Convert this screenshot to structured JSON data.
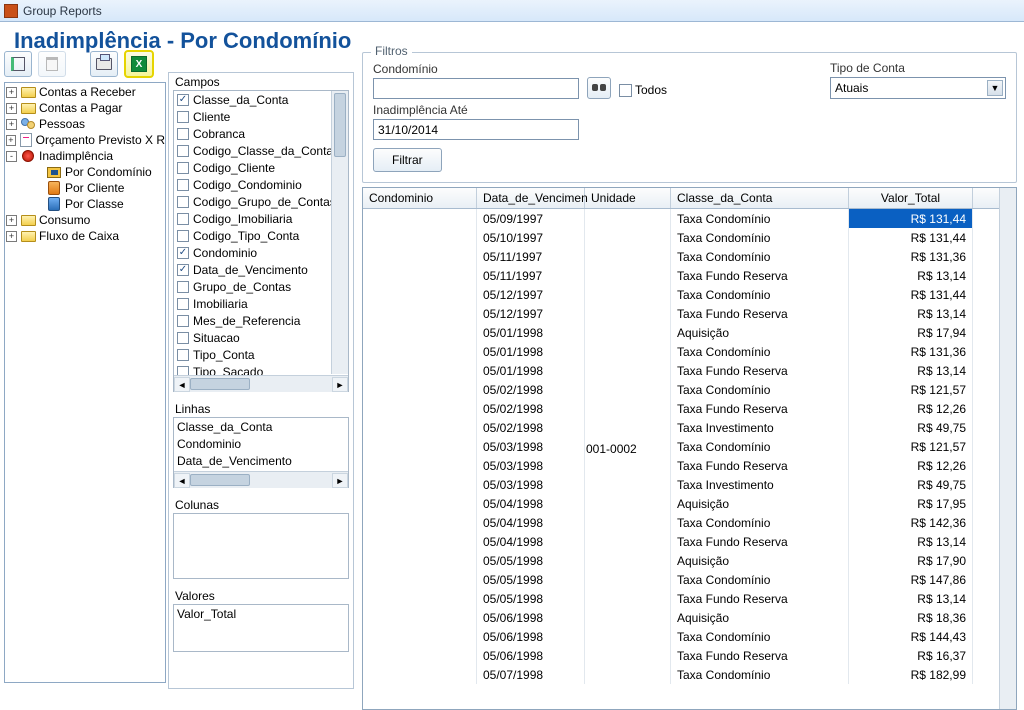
{
  "window_title": "Group Reports",
  "page_title": "Inadimplência - Por Condomínio",
  "tree": [
    {
      "exp": "+",
      "icon": "folder",
      "label": "Contas a Receber"
    },
    {
      "exp": "+",
      "icon": "folder",
      "label": "Contas a Pagar"
    },
    {
      "exp": "+",
      "icon": "people",
      "label": "Pessoas"
    },
    {
      "exp": "+",
      "icon": "doc",
      "label": "Orçamento Previsto X R"
    },
    {
      "exp": "-",
      "icon": "red",
      "label": "Inadimplência"
    },
    {
      "indent": 1,
      "icon": "pc",
      "label": "Por Condomínio"
    },
    {
      "indent": 1,
      "icon": "oper",
      "label": "Por Cliente"
    },
    {
      "indent": 1,
      "icon": "bper",
      "label": "Por Classe"
    },
    {
      "exp": "+",
      "icon": "folder-y",
      "label": "Consumo"
    },
    {
      "exp": "+",
      "icon": "folder-y",
      "label": "Fluxo de Caixa"
    }
  ],
  "campos_label": "Campos",
  "campos": [
    {
      "checked": true,
      "label": "Classe_da_Conta"
    },
    {
      "checked": false,
      "label": "Cliente"
    },
    {
      "checked": false,
      "label": "Cobranca"
    },
    {
      "checked": false,
      "label": "Codigo_Classe_da_Conta"
    },
    {
      "checked": false,
      "label": "Codigo_Cliente"
    },
    {
      "checked": false,
      "label": "Codigo_Condominio"
    },
    {
      "checked": false,
      "label": "Codigo_Grupo_de_Contas"
    },
    {
      "checked": false,
      "label": "Codigo_Imobiliaria"
    },
    {
      "checked": false,
      "label": "Codigo_Tipo_Conta"
    },
    {
      "checked": true,
      "label": "Condominio"
    },
    {
      "checked": true,
      "label": "Data_de_Vencimento"
    },
    {
      "checked": false,
      "label": "Grupo_de_Contas"
    },
    {
      "checked": false,
      "label": "Imobiliaria"
    },
    {
      "checked": false,
      "label": "Mes_de_Referencia"
    },
    {
      "checked": false,
      "label": "Situacao"
    },
    {
      "checked": false,
      "label": "Tipo_Conta"
    },
    {
      "checked": false,
      "label": "Tipo_Sacado"
    }
  ],
  "linhas_label": "Linhas",
  "linhas": [
    "Classe_da_Conta",
    "Condominio",
    "Data_de_Vencimento"
  ],
  "colunas_label": "Colunas",
  "valores_label": "Valores",
  "valores": [
    "Valor_Total"
  ],
  "filter": {
    "legend": "Filtros",
    "condo_label": "Condomínio",
    "condo_value": "",
    "todos_label": "Todos",
    "tipo_label": "Tipo de Conta",
    "tipo_value": "Atuais",
    "ate_label": "Inadimplência Até",
    "ate_value": "31/10/2014",
    "filtrar_label": "Filtrar"
  },
  "grid": {
    "headers": [
      "Condominio",
      "Data_de_Vencimen",
      "Unidade",
      "Classe_da_Conta",
      "Valor_Total"
    ],
    "unidade_overlay": "001-0002",
    "rows": [
      {
        "d": "05/09/1997",
        "c": "Taxa Condomínio",
        "v": "R$ 131,44",
        "hi": true
      },
      {
        "d": "05/10/1997",
        "c": "Taxa Condomínio",
        "v": "R$ 131,44"
      },
      {
        "d": "05/11/1997",
        "c": "Taxa Condomínio",
        "v": "R$ 131,36"
      },
      {
        "d": "05/11/1997",
        "c": "Taxa Fundo Reserva",
        "v": "R$ 13,14"
      },
      {
        "d": "05/12/1997",
        "c": "Taxa Condomínio",
        "v": "R$ 131,44"
      },
      {
        "d": "05/12/1997",
        "c": "Taxa Fundo Reserva",
        "v": "R$ 13,14"
      },
      {
        "d": "05/01/1998",
        "c": "Aquisição",
        "v": "R$ 17,94"
      },
      {
        "d": "05/01/1998",
        "c": "Taxa Condomínio",
        "v": "R$ 131,36"
      },
      {
        "d": "05/01/1998",
        "c": "Taxa Fundo Reserva",
        "v": "R$ 13,14"
      },
      {
        "d": "05/02/1998",
        "c": "Taxa Condomínio",
        "v": "R$ 121,57"
      },
      {
        "d": "05/02/1998",
        "c": "Taxa Fundo Reserva",
        "v": "R$ 12,26"
      },
      {
        "d": "05/02/1998",
        "c": "Taxa Investimento",
        "v": "R$ 49,75"
      },
      {
        "d": "05/03/1998",
        "c": "Taxa Condomínio",
        "v": "R$ 121,57"
      },
      {
        "d": "05/03/1998",
        "c": "Taxa Fundo Reserva",
        "v": "R$ 12,26"
      },
      {
        "d": "05/03/1998",
        "c": "Taxa Investimento",
        "v": "R$ 49,75"
      },
      {
        "d": "05/04/1998",
        "c": "Aquisição",
        "v": "R$ 17,95"
      },
      {
        "d": "05/04/1998",
        "c": "Taxa Condomínio",
        "v": "R$ 142,36"
      },
      {
        "d": "05/04/1998",
        "c": "Taxa Fundo Reserva",
        "v": "R$ 13,14"
      },
      {
        "d": "05/05/1998",
        "c": "Aquisição",
        "v": "R$ 17,90"
      },
      {
        "d": "05/05/1998",
        "c": "Taxa Condomínio",
        "v": "R$ 147,86"
      },
      {
        "d": "05/05/1998",
        "c": "Taxa Fundo Reserva",
        "v": "R$ 13,14"
      },
      {
        "d": "05/06/1998",
        "c": "Aquisição",
        "v": "R$ 18,36"
      },
      {
        "d": "05/06/1998",
        "c": "Taxa Condomínio",
        "v": "R$ 144,43"
      },
      {
        "d": "05/06/1998",
        "c": "Taxa Fundo Reserva",
        "v": "R$ 16,37"
      },
      {
        "d": "05/07/1998",
        "c": "Taxa Condomínio",
        "v": "R$ 182,99"
      }
    ]
  }
}
